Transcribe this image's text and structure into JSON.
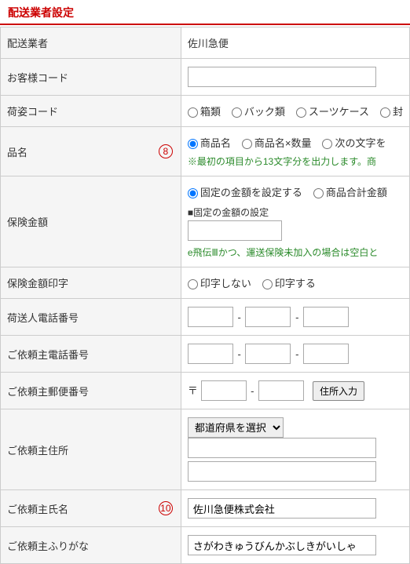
{
  "section_title": "配送業者設定",
  "rows": {
    "carrier": {
      "label": "配送業者",
      "value": "佐川急便"
    },
    "customer_code": {
      "label": "お客様コード",
      "value": ""
    },
    "package_code": {
      "label": "荷姿コード",
      "options": [
        "箱類",
        "バック類",
        "スーツケース",
        "封"
      ]
    },
    "product_name": {
      "label": "品名",
      "badge": "8",
      "options": [
        "商品名",
        "商品名×数量",
        "次の文字を"
      ],
      "selected": "商品名",
      "note": "※最初の項目から13文字分を出力します。商"
    },
    "insurance": {
      "label": "保険金額",
      "options": [
        "固定の金額を設定する",
        "商品合計金額"
      ],
      "selected": "固定の金額を設定する",
      "sub_label": "■固定の金額の設定",
      "value": "",
      "note": "e飛伝Ⅲかつ、運送保険未加入の場合は空白と"
    },
    "insurance_print": {
      "label": "保険金額印字",
      "options": [
        "印字しない",
        "印字する"
      ]
    },
    "shipper_phone": {
      "label": "荷送人電話番号",
      "v1": "",
      "v2": "",
      "v3": ""
    },
    "client_phone": {
      "label": "ご依頼主電話番号",
      "v1": "",
      "v2": "",
      "v3": ""
    },
    "client_zip": {
      "label": "ご依頼主郵便番号",
      "prefix": "〒",
      "v1": "",
      "v2": "",
      "btn": "住所入力"
    },
    "client_addr": {
      "label": "ご依頼主住所",
      "pref_placeholder": "都道府県を選択",
      "line1": "",
      "line2": ""
    },
    "client_name": {
      "label": "ご依頼主氏名",
      "badge": "10",
      "value": "佐川急便株式会社"
    },
    "client_kana": {
      "label": "ご依頼主ふりがな",
      "value": "さがわきゅうびんかぶしきがいしゃ"
    }
  }
}
